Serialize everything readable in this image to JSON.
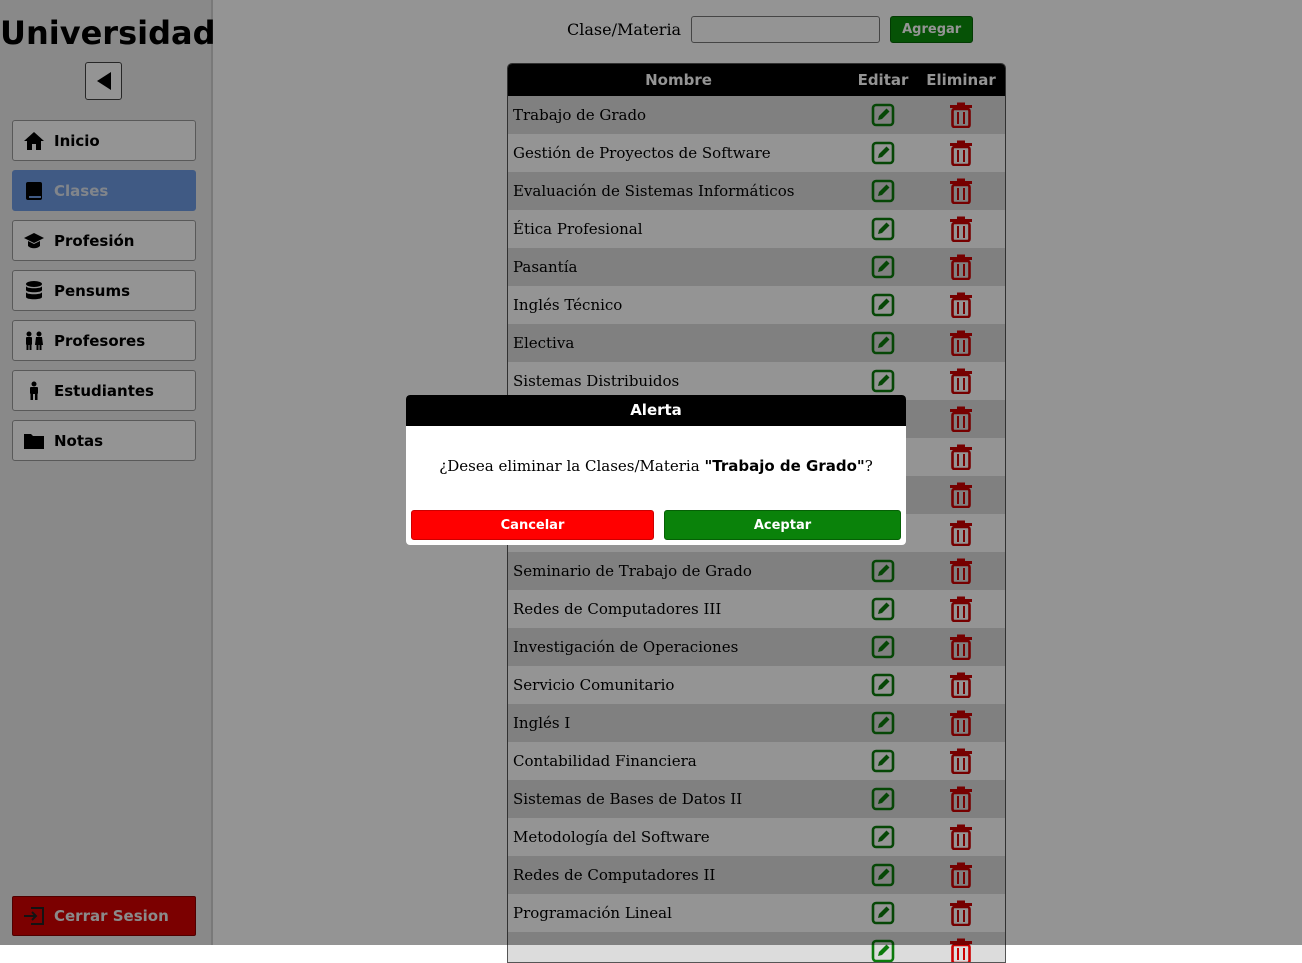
{
  "sidebar": {
    "title": "Universidad",
    "items": [
      {
        "label": "Inicio",
        "icon": "home-icon"
      },
      {
        "label": "Clases",
        "icon": "book-icon",
        "active": true
      },
      {
        "label": "Profesión",
        "icon": "graduation-cap-icon"
      },
      {
        "label": "Pensums",
        "icon": "database-icon"
      },
      {
        "label": "Profesores",
        "icon": "people-icon"
      },
      {
        "label": "Estudiantes",
        "icon": "person-icon"
      },
      {
        "label": "Notas",
        "icon": "folder-icon"
      }
    ],
    "logout_label": "Cerrar Sesion"
  },
  "form": {
    "label": "Clase/Materia",
    "input_value": "",
    "add_label": "Agregar"
  },
  "table": {
    "headers": [
      "Nombre",
      "Editar",
      "Eliminar"
    ],
    "rows": [
      "Trabajo de Grado",
      "Gestión de Proyectos de Software",
      "Evaluación de Sistemas Informáticos",
      "Ética Profesional",
      "Pasantía",
      "Inglés Técnico",
      "Electiva",
      "Sistemas Distribuidos",
      "",
      "",
      "",
      "",
      "Seminario de Trabajo de Grado",
      "Redes de Computadores III",
      "Investigación de Operaciones",
      "Servicio Comunitario",
      "Inglés I",
      "Contabilidad Financiera",
      "Sistemas de Bases de Datos II",
      "Metodología del Software",
      "Redes de Computadores II",
      "Programación Lineal",
      ""
    ]
  },
  "modal": {
    "title": "Alerta",
    "message_prefix": "¿Desea eliminar la Clases/Materia ",
    "message_item": "\"Trabajo de Grado\"",
    "message_suffix": "?",
    "cancel_label": "Cancelar",
    "accept_label": "Aceptar"
  },
  "colors": {
    "active_nav": "#6f9ce4",
    "edit_icon": "#0c7a0c",
    "delete_icon": "#cc0000",
    "logout": "#d40000"
  }
}
